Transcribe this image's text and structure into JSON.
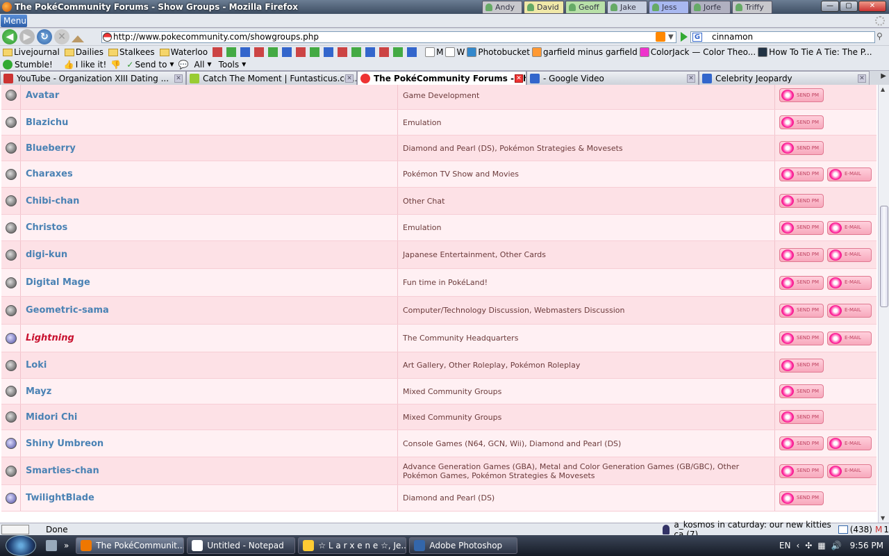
{
  "window": {
    "title": "The PokéCommunity Forums - Show Groups - Mozilla Firefox"
  },
  "profiles": [
    "Andy",
    "David",
    "Geoff",
    "Jake",
    "Jess",
    "Jorfe",
    "Triffy"
  ],
  "menu": {
    "label": "Menu"
  },
  "nav": {
    "url": "http://www.pokecommunity.com/showgroups.php",
    "search_value": "cinnamon"
  },
  "bookmarks": [
    {
      "label": "Livejournal",
      "icon": "folder-icon"
    },
    {
      "label": "Dailies",
      "icon": "folder-icon"
    },
    {
      "label": "Stalkees",
      "icon": "folder-icon"
    },
    {
      "label": "Waterloo",
      "icon": "folder-icon"
    },
    {
      "label": "M",
      "icon": "gmail-icon"
    },
    {
      "label": "W",
      "icon": "wikipedia-icon"
    },
    {
      "label": "Photobucket",
      "icon": "photobucket-icon"
    },
    {
      "label": "garfield minus garfield",
      "icon": "garfield-icon"
    },
    {
      "label": "ColorJack — Color Theo...",
      "icon": "colorjack-icon"
    },
    {
      "label": "How To Tie A Tie: The P...",
      "icon": "k-icon"
    }
  ],
  "toolbar": {
    "stumble": "Stumble!",
    "like": "I like it!",
    "sendto": "Send to",
    "all": "All",
    "tools": "Tools"
  },
  "tabs": [
    {
      "label": "YouTube - Organization XIII Dating ...",
      "active": false
    },
    {
      "label": "Catch The Moment | Funtasticus.co...",
      "active": false
    },
    {
      "label": "The PokéCommunity Forums - Sh...",
      "active": true
    },
    {
      "label": "- Google Video",
      "active": false
    },
    {
      "label": "Celebrity Jeopardy",
      "active": false
    }
  ],
  "buttons": {
    "send_pm": "SEND PM",
    "email": "E-MAIL"
  },
  "members": [
    {
      "name": "Avatar",
      "forums": "Game Development",
      "email": false,
      "style": "normal"
    },
    {
      "name": "Blazichu",
      "forums": "Emulation",
      "email": false,
      "style": "normal"
    },
    {
      "name": "Blueberry",
      "forums": "Diamond and Pearl (DS), Pokémon Strategies & Movesets",
      "email": false,
      "style": "normal"
    },
    {
      "name": "Charaxes",
      "forums": "Pokémon TV Show and Movies",
      "email": true,
      "style": "normal"
    },
    {
      "name": "Chibi-chan",
      "forums": "Other Chat",
      "email": false,
      "style": "normal"
    },
    {
      "name": "Christos",
      "forums": "Emulation",
      "email": true,
      "style": "normal"
    },
    {
      "name": "digi-kun",
      "forums": "Japanese Entertainment, Other Cards",
      "email": true,
      "style": "normal"
    },
    {
      "name": "Digital Mage",
      "forums": "Fun time in PokéLand!",
      "email": true,
      "style": "normal"
    },
    {
      "name": "Geometric-sama",
      "forums": "Computer/Technology Discussion, Webmasters Discussion",
      "email": true,
      "style": "normal"
    },
    {
      "name": "Lightning",
      "forums": "The Community Headquarters",
      "email": true,
      "style": "red"
    },
    {
      "name": "Loki",
      "forums": "Art Gallery, Other Roleplay, Pokémon Roleplay",
      "email": false,
      "style": "normal"
    },
    {
      "name": "Mayz",
      "forums": "Mixed Community Groups",
      "email": false,
      "style": "normal"
    },
    {
      "name": "Midori Chi",
      "forums": "Mixed Community Groups",
      "email": false,
      "style": "normal"
    },
    {
      "name": "Shiny Umbreon",
      "forums": "Console Games (N64, GCN, Wii), Diamond and Pearl (DS)",
      "email": true,
      "style": "normal"
    },
    {
      "name": "Smarties-chan",
      "forums": "Advance Generation Games (GBA), Metal and Color Generation Games (GB/GBC), Other Pokémon Games, Pokémon Strategies & Movesets",
      "email": true,
      "style": "normal"
    },
    {
      "name": "TwilightBlade",
      "forums": "Diamond and Pearl (DS)",
      "email": false,
      "style": "normal"
    }
  ],
  "status": {
    "text": "Done",
    "ticker": "a_kosmos in caturday: our new kitties ca (7)",
    "mail_count": "(438)",
    "mail_extra": "1"
  },
  "taskbar": {
    "items": [
      {
        "label": "The PokéCommunit...",
        "active": true
      },
      {
        "label": "Untitled - Notepad",
        "active": false
      },
      {
        "label": "☆ L a r x e n e ☆, Je...",
        "active": false
      },
      {
        "label": "Adobe Photoshop",
        "active": false
      }
    ],
    "overflow": "»",
    "lang": "EN",
    "clock": "9:56 PM"
  },
  "colors": {
    "row_odd": "#fde1e6",
    "row_even": "#fff0f3",
    "username": "#4a82b4",
    "username_red": "#c8102e"
  }
}
